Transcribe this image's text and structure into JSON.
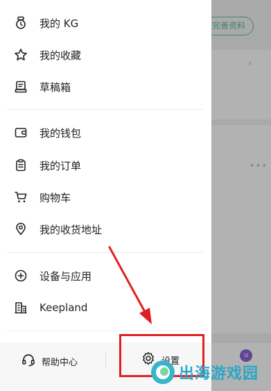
{
  "background": {
    "profile_pill": "完善资料",
    "avatar_letter": "u"
  },
  "drawer": {
    "group1": [
      {
        "label": "我的 KG",
        "icon": "kg-ring-icon"
      },
      {
        "label": "我的收藏",
        "icon": "star-icon"
      },
      {
        "label": "草稿箱",
        "icon": "drafts-icon"
      }
    ],
    "group2": [
      {
        "label": "我的钱包",
        "icon": "wallet-icon"
      },
      {
        "label": "我的订单",
        "icon": "clipboard-icon"
      },
      {
        "label": "购物车",
        "icon": "cart-icon"
      },
      {
        "label": "我的收货地址",
        "icon": "location-pin-icon"
      }
    ],
    "group3": [
      {
        "label": "设备与应用",
        "icon": "plus-circle-icon"
      },
      {
        "label": "Keepland",
        "icon": "building-icon"
      }
    ],
    "bottom": {
      "help_label": "帮助中心",
      "settings_label": "设置"
    }
  },
  "watermark": {
    "text": "出海游戏园"
  },
  "colors": {
    "annotation": "#e02020",
    "accent": "#5fbf9a",
    "watermark": "#2aa7c9"
  }
}
